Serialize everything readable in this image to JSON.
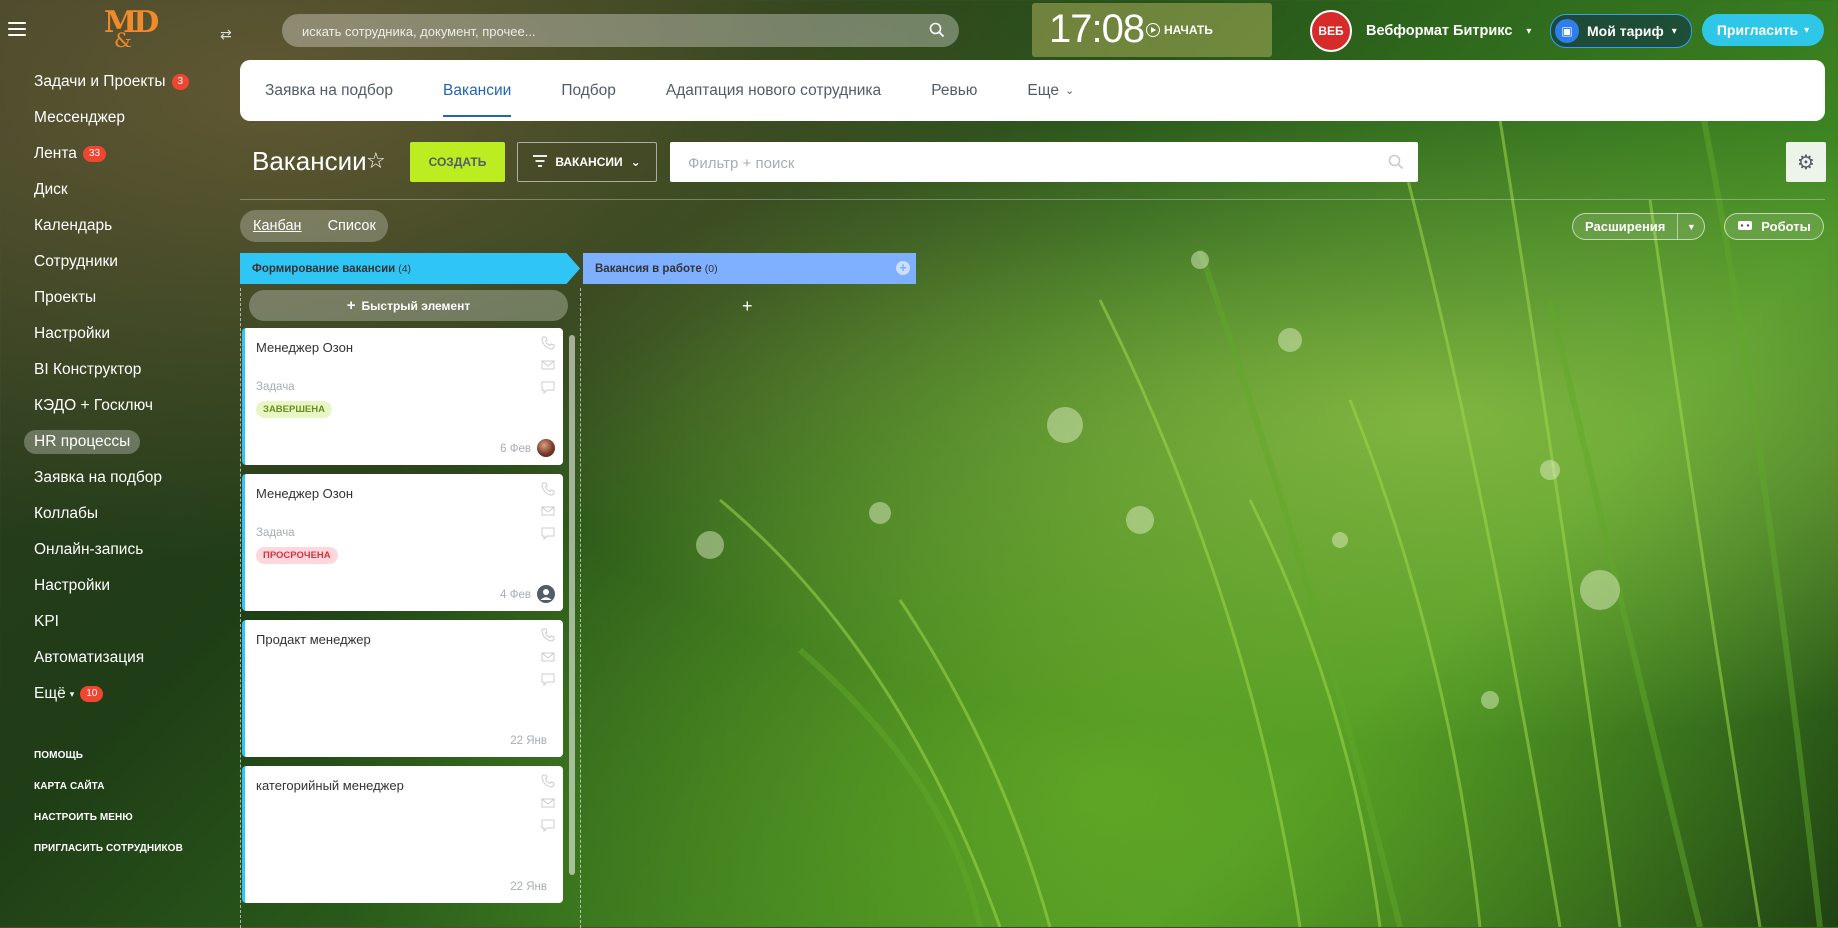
{
  "app": {
    "search_placeholder": "искать сотрудника, документ, прочее...",
    "clock_time": "17:08",
    "start_label": "НАЧАТЬ",
    "company_avatar": "ВЕБ",
    "company_name": "Вебформат Битрикс",
    "tariff_label": "Мой тариф",
    "invite_label": "Пригласить",
    "logo_text": "MD",
    "logo_amp": "&"
  },
  "sidebar": {
    "items": [
      {
        "label": "Задачи и Проекты",
        "badge": "3"
      },
      {
        "label": "Мессенджер"
      },
      {
        "label": "Лента",
        "badge": "33"
      },
      {
        "label": "Диск"
      },
      {
        "label": "Календарь"
      },
      {
        "label": "Сотрудники"
      },
      {
        "label": "Проекты"
      },
      {
        "label": "Настройки"
      },
      {
        "label": "BI Конструктор"
      },
      {
        "label": "КЭДО + Госключ"
      },
      {
        "label": "HR процессы",
        "active": true
      },
      {
        "label": "Заявка на подбор"
      },
      {
        "label": "Коллабы"
      },
      {
        "label": "Онлайн-запись"
      },
      {
        "label": "Настройки"
      },
      {
        "label": "KPI"
      },
      {
        "label": "Автоматизация"
      },
      {
        "label": "Ещё",
        "badge": "10",
        "chevron": true
      }
    ],
    "footer": [
      "ПОМОЩЬ",
      "КАРТА САЙТА",
      "НАСТРОИТЬ МЕНЮ",
      "ПРИГЛАСИТЬ СОТРУДНИКОВ"
    ]
  },
  "tabs": [
    {
      "label": "Заявка на подбор"
    },
    {
      "label": "Вакансии",
      "active": true
    },
    {
      "label": "Подбор"
    },
    {
      "label": "Адаптация нового сотрудника"
    },
    {
      "label": "Ревью"
    },
    {
      "label": "Еще"
    }
  ],
  "toolbar": {
    "title": "Вакансии",
    "create_label": "СОЗДАТЬ",
    "category_label": "ВАКАНСИИ",
    "filter_placeholder": "Фильтр + поиск",
    "view_kanban": "Канбан",
    "view_list": "Список",
    "extensions_label": "Расширения",
    "robots_label": "Роботы"
  },
  "kanban": {
    "columns": [
      {
        "title": "Формирование вакансии",
        "count": "(4)",
        "color": "#2fc6f6"
      },
      {
        "title": "Вакансия в работе",
        "count": "(0)",
        "color": "#7eb0ff"
      }
    ],
    "quick_add_label": "Быстрый элемент",
    "cards": [
      {
        "title": "Менеджер Озон",
        "kind": "Задача",
        "status": "ЗАВЕРШЕНА",
        "status_type": "done",
        "date": "6 Фев",
        "avatar": "photo"
      },
      {
        "title": "Менеджер Озон",
        "kind": "Задача",
        "status": "ПРОСРОЧЕНА",
        "status_type": "late",
        "date": "4 Фев",
        "avatar": "default"
      },
      {
        "title": "Продакт менеджер",
        "date": "22 Янв"
      },
      {
        "title": "категорийный менеджер",
        "date": "22 Янв"
      }
    ]
  },
  "colors": {
    "accent": "#2067b0",
    "create": "#bbed21",
    "invite": "#2fc7e7",
    "badge": "#f0452f"
  }
}
